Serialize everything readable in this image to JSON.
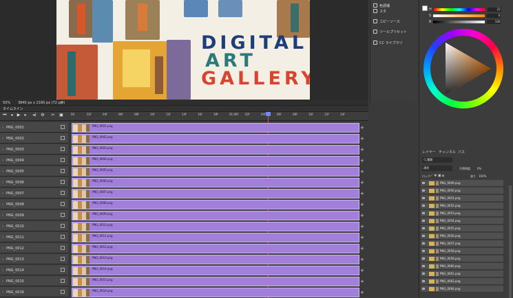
{
  "artwork": {
    "title_lines": [
      "DIGITAL",
      "ART",
      "GALLERY"
    ],
    "title_colors": [
      "#1f3e78",
      "#d8452e",
      "#e0a72e",
      "#2c7a78",
      "#e0783e"
    ]
  },
  "statusbar": {
    "zoom": "50%",
    "doc_info": "3840 px x 2160 px (72 ppi)"
  },
  "midpanel": {
    "items": [
      {
        "label": "色調補",
        "icon": "adjust-icon"
      },
      {
        "label": "スタ",
        "icon": "style-icon"
      },
      {
        "label": "コピーソース",
        "icon": "clone-source-icon"
      },
      {
        "label": "ツールプリセット",
        "icon": "tool-preset-icon"
      },
      {
        "label": "CC ライブラリ",
        "icon": "cc-library-icon"
      }
    ]
  },
  "color": {
    "sliders": [
      {
        "label": "H",
        "value": "22"
      },
      {
        "label": "S",
        "value": "0"
      },
      {
        "label": "B",
        "value": "100"
      }
    ]
  },
  "timeline": {
    "tab_label": "タイムライン",
    "timecodes": [
      "00",
      "02f",
      "04f",
      "06f",
      "08f",
      "10f",
      "12f",
      "14f",
      "16f",
      "18f",
      "01:00f",
      "02f",
      "04f",
      "06f",
      "08f",
      "10f",
      "12f",
      "14f"
    ],
    "tracks": [
      {
        "label": "PNG_0001",
        "clip": "PNG_0001.png"
      },
      {
        "label": "PNG_0002",
        "clip": "PNG_0002.png"
      },
      {
        "label": "PNG_0003",
        "clip": "PNG_0003.png"
      },
      {
        "label": "PNG_0004",
        "clip": "PNG_0004.png"
      },
      {
        "label": "PNG_0005",
        "clip": "PNG_0005.png"
      },
      {
        "label": "PNG_0006",
        "clip": "PNG_0006.png"
      },
      {
        "label": "PNG_0007",
        "clip": "PNG_0007.png"
      },
      {
        "label": "PNG_0008",
        "clip": "PNG_0008.png"
      },
      {
        "label": "PNG_0009",
        "clip": "PNG_0009.png"
      },
      {
        "label": "PNG_0010",
        "clip": "PNG_0010.png"
      },
      {
        "label": "PNG_0011",
        "clip": "PNG_0011.png"
      },
      {
        "label": "PNG_0012",
        "clip": "PNG_0012.png"
      },
      {
        "label": "PNG_0013",
        "clip": "PNG_0013.png"
      },
      {
        "label": "PNG_0014",
        "clip": "PNG_0014.png"
      },
      {
        "label": "PNG_0015",
        "clip": "PNG_0015.png"
      },
      {
        "label": "PNG_0016",
        "clip": "PNG_0016.png"
      }
    ]
  },
  "layers": {
    "tabs": [
      "レイヤー",
      "チャンネル",
      "パス"
    ],
    "filter": "種類",
    "blend_mode": "通常",
    "opacity_label": "不透明度",
    "opacity_value": "0%",
    "lock_label": "ロック",
    "fill_label": "塗り",
    "fill_value": "100%",
    "items": [
      "PNG_0049.png",
      "PNG_0050.png",
      "PNG_0051.png",
      "PNG_0052.png",
      "PNG_0053.png",
      "PNG_0054.png",
      "PNG_0055.png",
      "PNG_0056.png",
      "PNG_0057.png",
      "PNG_0058.png",
      "PNG_0059.png",
      "PNG_0060.png",
      "PNG_0061.png",
      "PNG_0062.png",
      "PNG_0064.png"
    ]
  }
}
